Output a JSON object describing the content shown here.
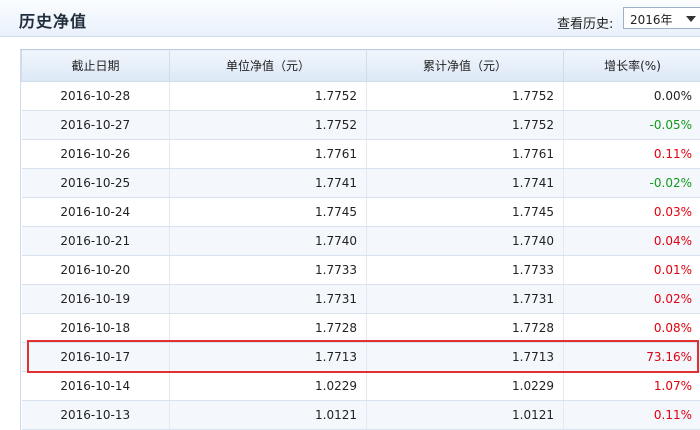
{
  "header": {
    "title": "历史净值",
    "history_label": "查看历史:",
    "year_selected": "2016年"
  },
  "table": {
    "columns": [
      "截止日期",
      "单位净值（元）",
      "累计净值（元）",
      "增长率(%)"
    ],
    "rows": [
      {
        "date": "2016-10-28",
        "unit_nav": "1.7752",
        "cum_nav": "1.7752",
        "rate": "0.00%",
        "trend": "flat"
      },
      {
        "date": "2016-10-27",
        "unit_nav": "1.7752",
        "cum_nav": "1.7752",
        "rate": "-0.05%",
        "trend": "down"
      },
      {
        "date": "2016-10-26",
        "unit_nav": "1.7761",
        "cum_nav": "1.7761",
        "rate": "0.11%",
        "trend": "up"
      },
      {
        "date": "2016-10-25",
        "unit_nav": "1.7741",
        "cum_nav": "1.7741",
        "rate": "-0.02%",
        "trend": "down"
      },
      {
        "date": "2016-10-24",
        "unit_nav": "1.7745",
        "cum_nav": "1.7745",
        "rate": "0.03%",
        "trend": "up"
      },
      {
        "date": "2016-10-21",
        "unit_nav": "1.7740",
        "cum_nav": "1.7740",
        "rate": "0.04%",
        "trend": "up"
      },
      {
        "date": "2016-10-20",
        "unit_nav": "1.7733",
        "cum_nav": "1.7733",
        "rate": "0.01%",
        "trend": "up"
      },
      {
        "date": "2016-10-19",
        "unit_nav": "1.7731",
        "cum_nav": "1.7731",
        "rate": "0.02%",
        "trend": "up"
      },
      {
        "date": "2016-10-18",
        "unit_nav": "1.7728",
        "cum_nav": "1.7728",
        "rate": "0.08%",
        "trend": "up"
      },
      {
        "date": "2016-10-17",
        "unit_nav": "1.7713",
        "cum_nav": "1.7713",
        "rate": "73.16%",
        "trend": "up"
      },
      {
        "date": "2016-10-14",
        "unit_nav": "1.0229",
        "cum_nav": "1.0229",
        "rate": "1.07%",
        "trend": "up"
      },
      {
        "date": "2016-10-13",
        "unit_nav": "1.0121",
        "cum_nav": "1.0121",
        "rate": "0.11%",
        "trend": "up"
      }
    ]
  },
  "colors": {
    "up": "#e0000f",
    "down": "#129a1a",
    "highlight": "#e03030"
  }
}
